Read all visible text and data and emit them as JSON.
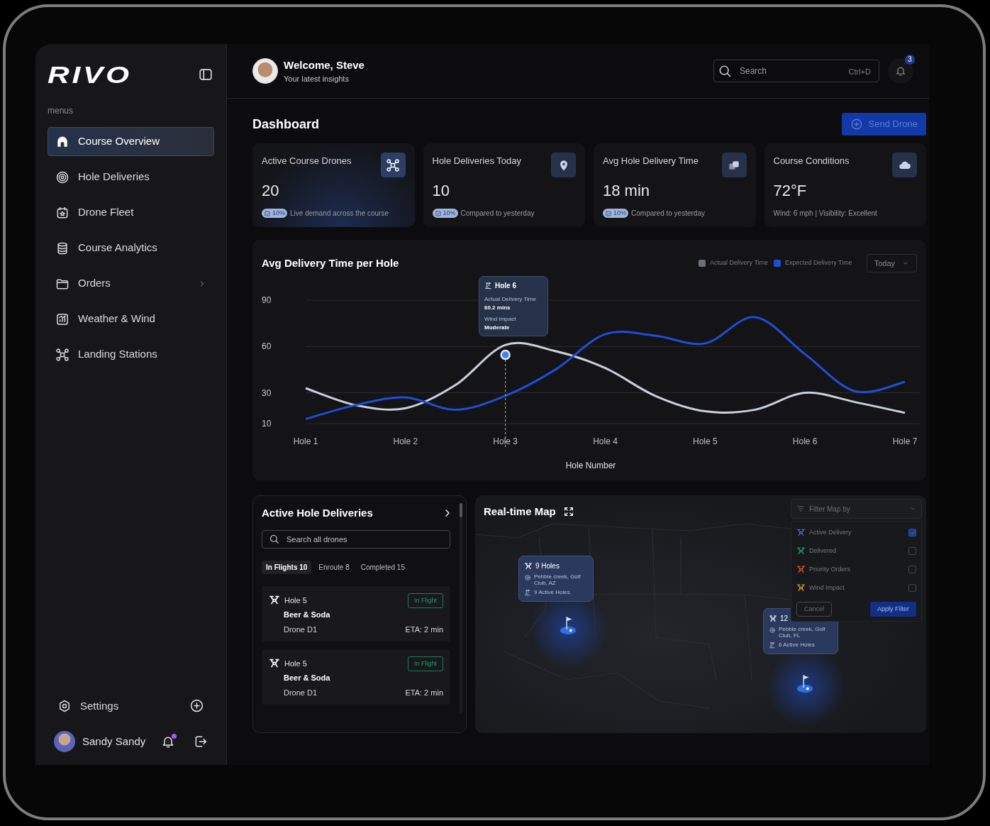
{
  "sidebar": {
    "logo": "RIVO",
    "section_label": "menus",
    "items": [
      {
        "label": "Course Overview",
        "selected": true,
        "has_submenu": false
      },
      {
        "label": "Hole Deliveries",
        "selected": false,
        "has_submenu": false
      },
      {
        "label": "Drone Fleet",
        "selected": false,
        "has_submenu": false
      },
      {
        "label": "Course Analytics",
        "selected": false,
        "has_submenu": false
      },
      {
        "label": "Orders",
        "selected": false,
        "has_submenu": true
      },
      {
        "label": "Weather & Wind",
        "selected": false,
        "has_submenu": false
      },
      {
        "label": "Landing Stations",
        "selected": false,
        "has_submenu": false
      }
    ],
    "settings": "Settings",
    "user": {
      "name": "Sandy Sandy",
      "has_notification": true
    }
  },
  "header": {
    "title": "Welcome, Steve",
    "subtitle": "Your latest insights",
    "search": {
      "placeholder": "Search",
      "shortcut": "Ctrl+D"
    },
    "notification_count": "3"
  },
  "page": {
    "title": "Dashboard",
    "action": "Send Drone"
  },
  "stats": [
    {
      "title": "Active Course Drones",
      "value": "20",
      "badge": "10%",
      "caption": "Live demand across the course",
      "highlighted": true
    },
    {
      "title": "Hole Deliveries Today",
      "value": "10",
      "badge": "10%",
      "caption": "Compared to yesterday",
      "highlighted": false
    },
    {
      "title": "Avg Hole Delivery Time",
      "value": "18 min",
      "badge": "10%",
      "caption": "Compared to yesterday",
      "highlighted": false
    },
    {
      "title": "Course Conditions",
      "value": "72°F",
      "caption": "Wind: 6 mph | Visibility: Excellent",
      "highlighted": false
    }
  ],
  "chart_panel": {
    "title": "Avg Delivery Time per Hole",
    "period": "Today",
    "tooltip": {
      "title": "Hole 6",
      "rows": [
        {
          "label": "Actual Delivery Time",
          "value": "60.2 mins"
        },
        {
          "label": "Wind Impact",
          "value": "Moderate"
        }
      ]
    },
    "chart_data": {
      "type": "line",
      "xlabel": "Hole Number",
      "categories": [
        "Hole 1",
        null,
        "Hole 2",
        null,
        "Hole 3",
        null,
        "Hole 4",
        null,
        "Hole 5",
        null,
        "Hole 6",
        null,
        "Hole 7"
      ],
      "ylim": [
        10,
        90
      ],
      "yticks": [
        10,
        30,
        60,
        90
      ],
      "series": [
        {
          "name": "Actual Delivery Time",
          "color": "#c9cfdc",
          "values": [
            33,
            22,
            20,
            35,
            61,
            57,
            46,
            28,
            18,
            19,
            30,
            24,
            17
          ]
        },
        {
          "name": "Expected Delivery Time",
          "color": "#1d4ed8",
          "values": [
            13,
            22,
            27,
            19,
            28,
            45,
            68,
            67,
            62,
            79,
            55,
            31,
            37
          ]
        }
      ]
    }
  },
  "deliveries": {
    "title": "Active Hole Deliveries",
    "search_placeholder": "Search all drones",
    "tabs": [
      {
        "label": "In Flights 10",
        "selected": true
      },
      {
        "label": "Enroute 8",
        "selected": false
      },
      {
        "label": "Completed 15",
        "selected": false
      }
    ],
    "items": [
      {
        "hole": "Hole 5",
        "order": "Beer & Soda",
        "drone": "Drone D1",
        "status": "In Flight",
        "eta": "ETA: 2 min"
      },
      {
        "hole": "Hole 5",
        "order": "Beer & Soda",
        "drone": "Drone D1",
        "status": "In Flight",
        "eta": "ETA: 2 min"
      }
    ]
  },
  "map": {
    "title": "Real-time Map",
    "markers": [
      {
        "title": "9 Holes",
        "location": "Pebble creek, Golf Club, AZ",
        "holes": "9 Active Holes"
      },
      {
        "title": "12",
        "location": "Pebble creek, Golf Club, FL",
        "holes": "6 Active Holes"
      }
    ],
    "filter": {
      "label": "Filter Map by",
      "options": [
        {
          "label": "Active Delivery",
          "color": "#3b6fd8",
          "checked": true
        },
        {
          "label": "Delivered",
          "color": "#22a55a",
          "checked": false
        },
        {
          "label": "Priority Orders",
          "color": "#e0552b",
          "checked": false
        },
        {
          "label": "Wind Impact",
          "color": "#d99a2b",
          "checked": false
        }
      ],
      "cancel": "Cancel",
      "apply": "Apply Filter"
    }
  }
}
